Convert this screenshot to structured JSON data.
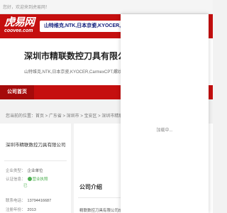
{
  "topbar": {
    "welcome": "您好，欢迎来到虎易网！"
  },
  "logo": {
    "cn": "虎易网",
    "en": "coovee.com"
  },
  "ad": {
    "text": "山特维克,NTK,日本京瓷,KYOCER,Carmex"
  },
  "company": {
    "name": "深圳市精联数控刀具有限公司",
    "brands": "山特维克,NTK,日本京瓷,KYOCER,CarmexCPT,螺纹刀具"
  },
  "nav": {
    "home": "公司首页"
  },
  "breadcrumb": "您当前的位置：首页 > 广东省 > 深圳市 > 宝安区 > 深圳市精联数控刀具有",
  "card": {
    "name": "深圳市精联数控刀具有限公司",
    "type_label": "企业类型：",
    "type_value": "企业单位",
    "cert_label": "认证信息：",
    "cert_value": "营业执照",
    "cert_value2": "已",
    "phone_label": "联系电话：",
    "phone_value": "13794416687",
    "year_label": "注册年份：",
    "year_value": "2013"
  },
  "main": {
    "heading": "公司介绍",
    "intro": "精联数控刀具有限公司成立于"
  },
  "overlay": {
    "loading": "加载中..."
  },
  "colors": {
    "brand_red": "#c50f0f",
    "nav_active": "#a50b0b",
    "verified": "#4caf50"
  }
}
